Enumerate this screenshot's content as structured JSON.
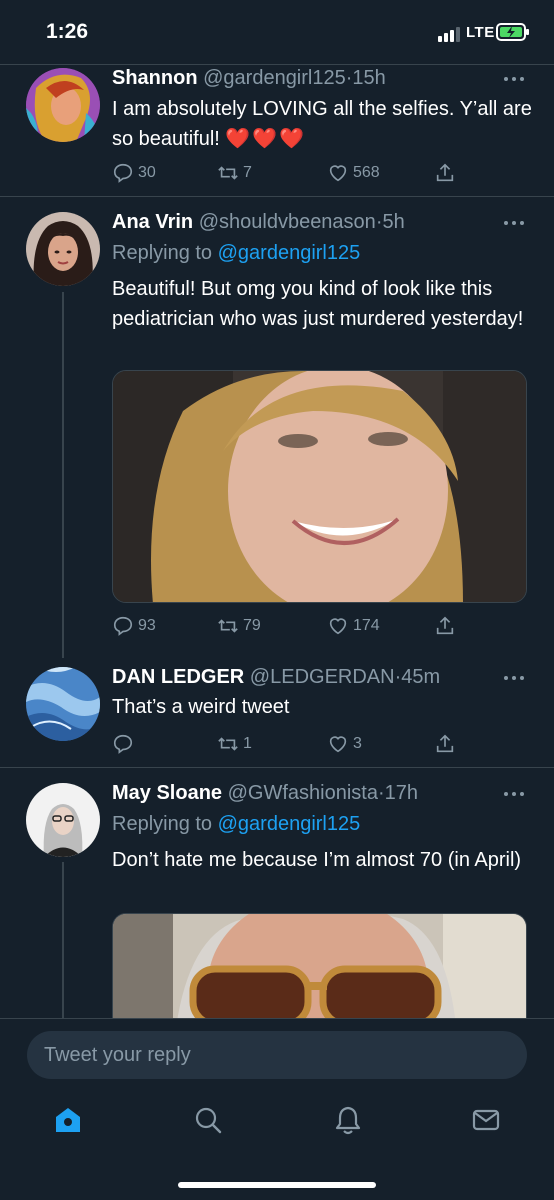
{
  "status_bar": {
    "time": "1:26",
    "network": "LTE"
  },
  "tweets": [
    {
      "name": "Shannon",
      "handle": "@gardengirl125",
      "separator": "·",
      "time": "15h",
      "text": "I am absolutely LOVING all the selfies. Y’all are so beautiful!",
      "emoji": "❤️❤️❤️",
      "replies": "30",
      "retweets": "7",
      "likes": "568"
    },
    {
      "name": "Ana Vrin",
      "handle": "@shouldvbeenason",
      "separator": "·",
      "time": "5h",
      "replying_to_prefix": "Replying to",
      "replying_to": "@gardengirl125",
      "text": "Beautiful! But omg you kind of look like this pediatrician who was just murdered yesterday!",
      "replies": "93",
      "retweets": "79",
      "likes": "174"
    },
    {
      "name": "DAN LEDGER",
      "handle": "@LEDGERDAN",
      "separator": "·",
      "time": "45m",
      "text": "That’s a weird tweet",
      "replies": "",
      "retweets": "1",
      "likes": "3"
    },
    {
      "name": "May Sloane",
      "handle": "@GWfashionista",
      "separator": "·",
      "time": "17h",
      "replying_to_prefix": "Replying to",
      "replying_to": "@gardengirl125",
      "text": "Don’t hate me because I’m almost 70 (in April)"
    }
  ],
  "reply_box": {
    "placeholder": "Tweet your reply"
  },
  "tabs": [
    {
      "icon": "home-icon",
      "active": true
    },
    {
      "icon": "search-icon",
      "active": false
    },
    {
      "icon": "notifications-icon",
      "active": false
    },
    {
      "icon": "messages-icon",
      "active": false
    }
  ],
  "colors": {
    "background": "#15202b",
    "accent": "#1da1f2",
    "muted": "#8899a6",
    "divider": "#38444d",
    "heart": "#e0245e"
  }
}
